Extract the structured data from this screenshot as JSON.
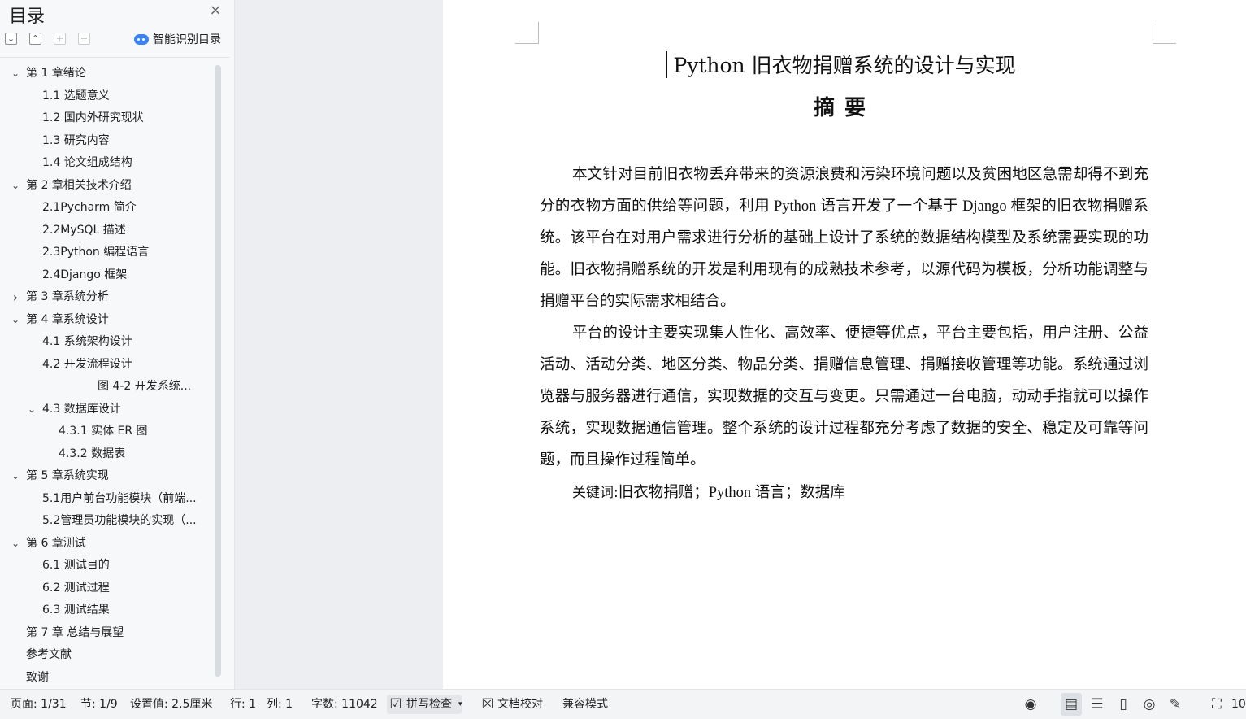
{
  "sidebar": {
    "title": "目录",
    "smart_toc_label": "智能识别目录",
    "items": [
      {
        "label": "第 1 章绪论",
        "level": 1,
        "expanded": true
      },
      {
        "label": "1.1 选题意义",
        "level": 2
      },
      {
        "label": "1.2 国内外研究现状",
        "level": 2
      },
      {
        "label": "1.3 研究内容",
        "level": 2
      },
      {
        "label": "1.4 论文组成结构",
        "level": 2
      },
      {
        "label": "第 2 章相关技术介绍",
        "level": 1,
        "expanded": true
      },
      {
        "label": "2.1Pycharm 简介",
        "level": 2
      },
      {
        "label": "2.2MySQL 描述",
        "level": 2
      },
      {
        "label": "2.3Python 编程语言",
        "level": 2
      },
      {
        "label": "2.4Django 框架",
        "level": 2
      },
      {
        "label": "第 3 章系统分析",
        "level": 1,
        "expanded": false
      },
      {
        "label": "第 4 章系统设计",
        "level": 1,
        "expanded": true
      },
      {
        "label": "4.1 系统架构设计",
        "level": 2
      },
      {
        "label": "4.2 开发流程设计",
        "level": 2
      },
      {
        "label": "图 4-2 开发系统...",
        "level": 4
      },
      {
        "label": "4.3 数据库设计",
        "level": 2,
        "expanded": true
      },
      {
        "label": "4.3.1 实体 ER 图",
        "level": 3
      },
      {
        "label": "4.3.2 数据表",
        "level": 3
      },
      {
        "label": "第 5 章系统实现",
        "level": 1,
        "expanded": true
      },
      {
        "label": "5.1用户前台功能模块（前端...",
        "level": 2
      },
      {
        "label": "5.2管理员功能模块的实现（...",
        "level": 2
      },
      {
        "label": "第 6 章测试",
        "level": 1,
        "expanded": true
      },
      {
        "label": "6.1 测试目的",
        "level": 2
      },
      {
        "label": "6.2 测试过程",
        "level": 2
      },
      {
        "label": "6.3 测试结果",
        "level": 2
      },
      {
        "label": "第 7 章  总结与展望",
        "level": 1
      },
      {
        "label": "参考文献",
        "level": 1
      },
      {
        "label": "致谢",
        "level": 1
      }
    ]
  },
  "document": {
    "title": "Python 旧衣物捐赠系统的设计与实现",
    "abstract_heading": "摘要",
    "paragraphs": [
      "本文针对目前旧衣物丢弃带来的资源浪费和污染环境问题以及贫困地区急需却得不到充分的衣物方面的供给等问题，利用 Python 语言开发了一个基于 Django 框架的旧衣物捐赠系统。该平台在对用户需求进行分析的基础上设计了系统的数据结构模型及系统需要实现的功能。旧衣物捐赠系统的开发是利用现有的成熟技术参考，以源代码为模板，分析功能调整与捐赠平台的实际需求相结合。",
      "平台的设计主要实现集人性化、高效率、便捷等优点，平台主要包括，用户注册、公益活动、活动分类、地区分类、物品分类、捐赠信息管理、捐赠接收管理等功能。系统通过浏览器与服务器进行通信，实现数据的交互与变更。只需通过一台电脑，动动手指就可以操作系统，实现数据通信管理。整个系统的设计过程都充分考虑了数据的安全、稳定及可靠等问题，而且操作过程简单。"
    ],
    "keywords_label": "关键词:",
    "keywords_text": "旧衣物捐赠；Python 语言；数据库"
  },
  "statusbar": {
    "page": "页面: 1/31",
    "section": "节: 1/9",
    "setting": "设置值: 2.5厘米",
    "row": "行: 1",
    "col": "列: 1",
    "word_count": "字数: 11042",
    "spell_check": "拼写检查",
    "doc_proof": "文档校对",
    "compat_mode": "兼容模式",
    "zoom": "10"
  }
}
